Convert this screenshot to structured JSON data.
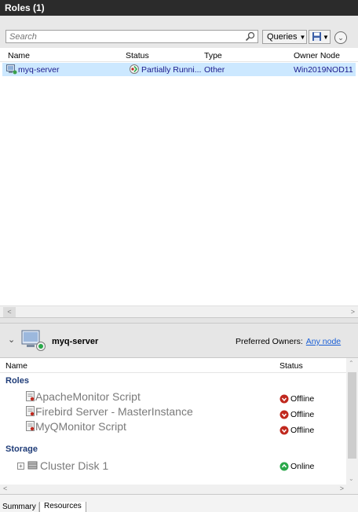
{
  "panel": {
    "title": "Roles (1)"
  },
  "search": {
    "placeholder": "Search",
    "queries_label": "Queries"
  },
  "columns": {
    "name": "Name",
    "status": "Status",
    "type": "Type",
    "owner": "Owner Node"
  },
  "rows": [
    {
      "name": "myq-server",
      "status": "Partially Runni...",
      "type": "Other",
      "owner": "Win2019NOD11"
    }
  ],
  "detail": {
    "title": "myq-server",
    "preferred_owners_label": "Preferred Owners:",
    "preferred_owners_link": "Any node",
    "col_name": "Name",
    "col_status": "Status",
    "groups": {
      "roles": "Roles",
      "storage": "Storage"
    },
    "resources": [
      {
        "name": "ApacheMonitor Script",
        "status": "Offline"
      },
      {
        "name": "Firebird Server - MasterInstance",
        "status": "Offline"
      },
      {
        "name": "MyQMonitor Script",
        "status": "Offline"
      }
    ],
    "storage": [
      {
        "name": "Cluster Disk 1",
        "status": "Online"
      }
    ]
  },
  "tabs": [
    "Summary",
    "Resources"
  ],
  "colors": {
    "selected_row": "#cce8ff",
    "title_bar": "#2b2b2b",
    "offline": "#c0281e",
    "online": "#2aa84a",
    "link": "#1a5fd6"
  },
  "icons": [
    "search-icon",
    "save-icon",
    "chevron-down-icon",
    "cluster-role-icon",
    "partial-status-icon",
    "script-resource-icon",
    "offline-status-icon",
    "online-status-icon",
    "disk-icon"
  ]
}
